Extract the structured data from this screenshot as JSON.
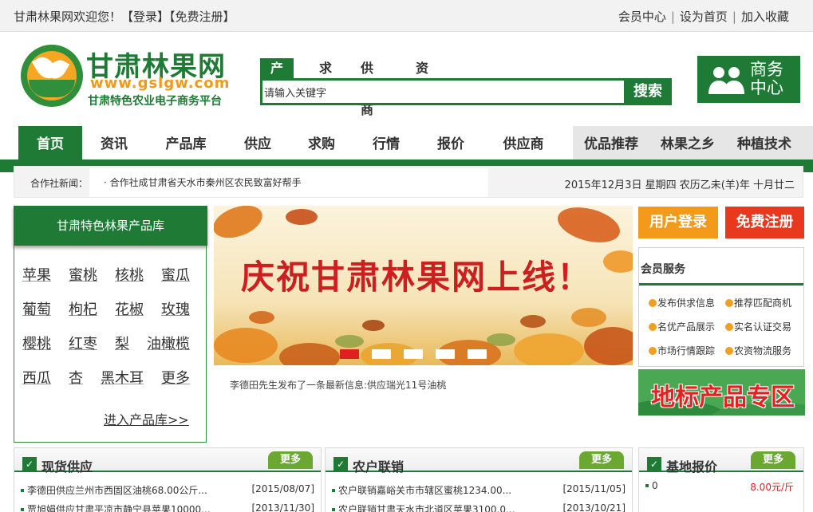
{
  "topbar": {
    "welcome": "甘肃林果网欢迎您！",
    "login": "【登录】",
    "register": "【免费注册】",
    "links": [
      "会员中心",
      "设为首页",
      "加入收藏"
    ]
  },
  "brand": {
    "title": "甘肃林果网",
    "url": "www.gslgw.com",
    "subtitle": "甘肃特色农业电子商务平台"
  },
  "search": {
    "tabs": [
      "产品",
      "求购",
      "供应商",
      "资讯"
    ],
    "placeholder": "请输入关键字",
    "value": "请输入关键字",
    "button": "搜索"
  },
  "biz_center": {
    "line1": "商务",
    "line2": "中心"
  },
  "nav": {
    "items": [
      "首页",
      "资讯",
      "产品库",
      "供应",
      "求购",
      "行情",
      "报价",
      "供应商"
    ],
    "right_items": [
      "优品推荐",
      "林果之乡",
      "种植技术"
    ]
  },
  "newsbar": {
    "label": "合作社新闻：",
    "ticker": "· 合作社成甘肃省天水市秦州区农民致富好帮手",
    "date": "2015年12月3日 星期四 农历乙未(羊)年 十月廿二"
  },
  "products": {
    "title": "甘肃特色林果产品库",
    "items": [
      "苹果",
      "蜜桃",
      "核桃",
      "蜜瓜",
      "葡萄",
      "枸杞",
      "花椒",
      "玫瑰",
      "樱桃",
      "红枣",
      "梨",
      "油橄榄",
      "西瓜",
      "杏",
      "黑木耳",
      "更多"
    ],
    "enter": "进入产品库>>"
  },
  "banner": {
    "headline": "庆祝甘肃林果网上线！",
    "slide_count": 5,
    "active_slide": 1,
    "caption": "李德田先生发布了一条最新信息:供应瑞光11号油桃"
  },
  "account": {
    "login": "用户登录",
    "register": "免费注册"
  },
  "member": {
    "title": "会员服务",
    "services": [
      "发布供求信息",
      "推荐匹配商机",
      "名优产品展示",
      "实名认证交易",
      "市场行情跟踪",
      "农资物流服务"
    ]
  },
  "geo": {
    "label": "地标产品专区"
  },
  "sections": [
    {
      "title": "现货供应",
      "more": "更多",
      "rows": [
        {
          "text": "李德田供应兰州市西固区油桃68.00公斤...",
          "date": "[2015/08/07]"
        },
        {
          "text": "贾旭娟供应甘肃平凉市静宁县苹果10000...",
          "date": "[2013/11/30]"
        }
      ]
    },
    {
      "title": "农户联销",
      "more": "更多",
      "rows": [
        {
          "text": "农户联销嘉峪关市市辖区蜜桃1234.00...",
          "date": "[2015/11/05]"
        },
        {
          "text": "农户联销甘肃天水市北道区苹果3100.0...",
          "date": "[2013/10/21]"
        }
      ]
    },
    {
      "title": "基地报价",
      "more": "更多",
      "rows": [
        {
          "text": "0",
          "price": "8.00元/斤"
        }
      ]
    }
  ]
}
